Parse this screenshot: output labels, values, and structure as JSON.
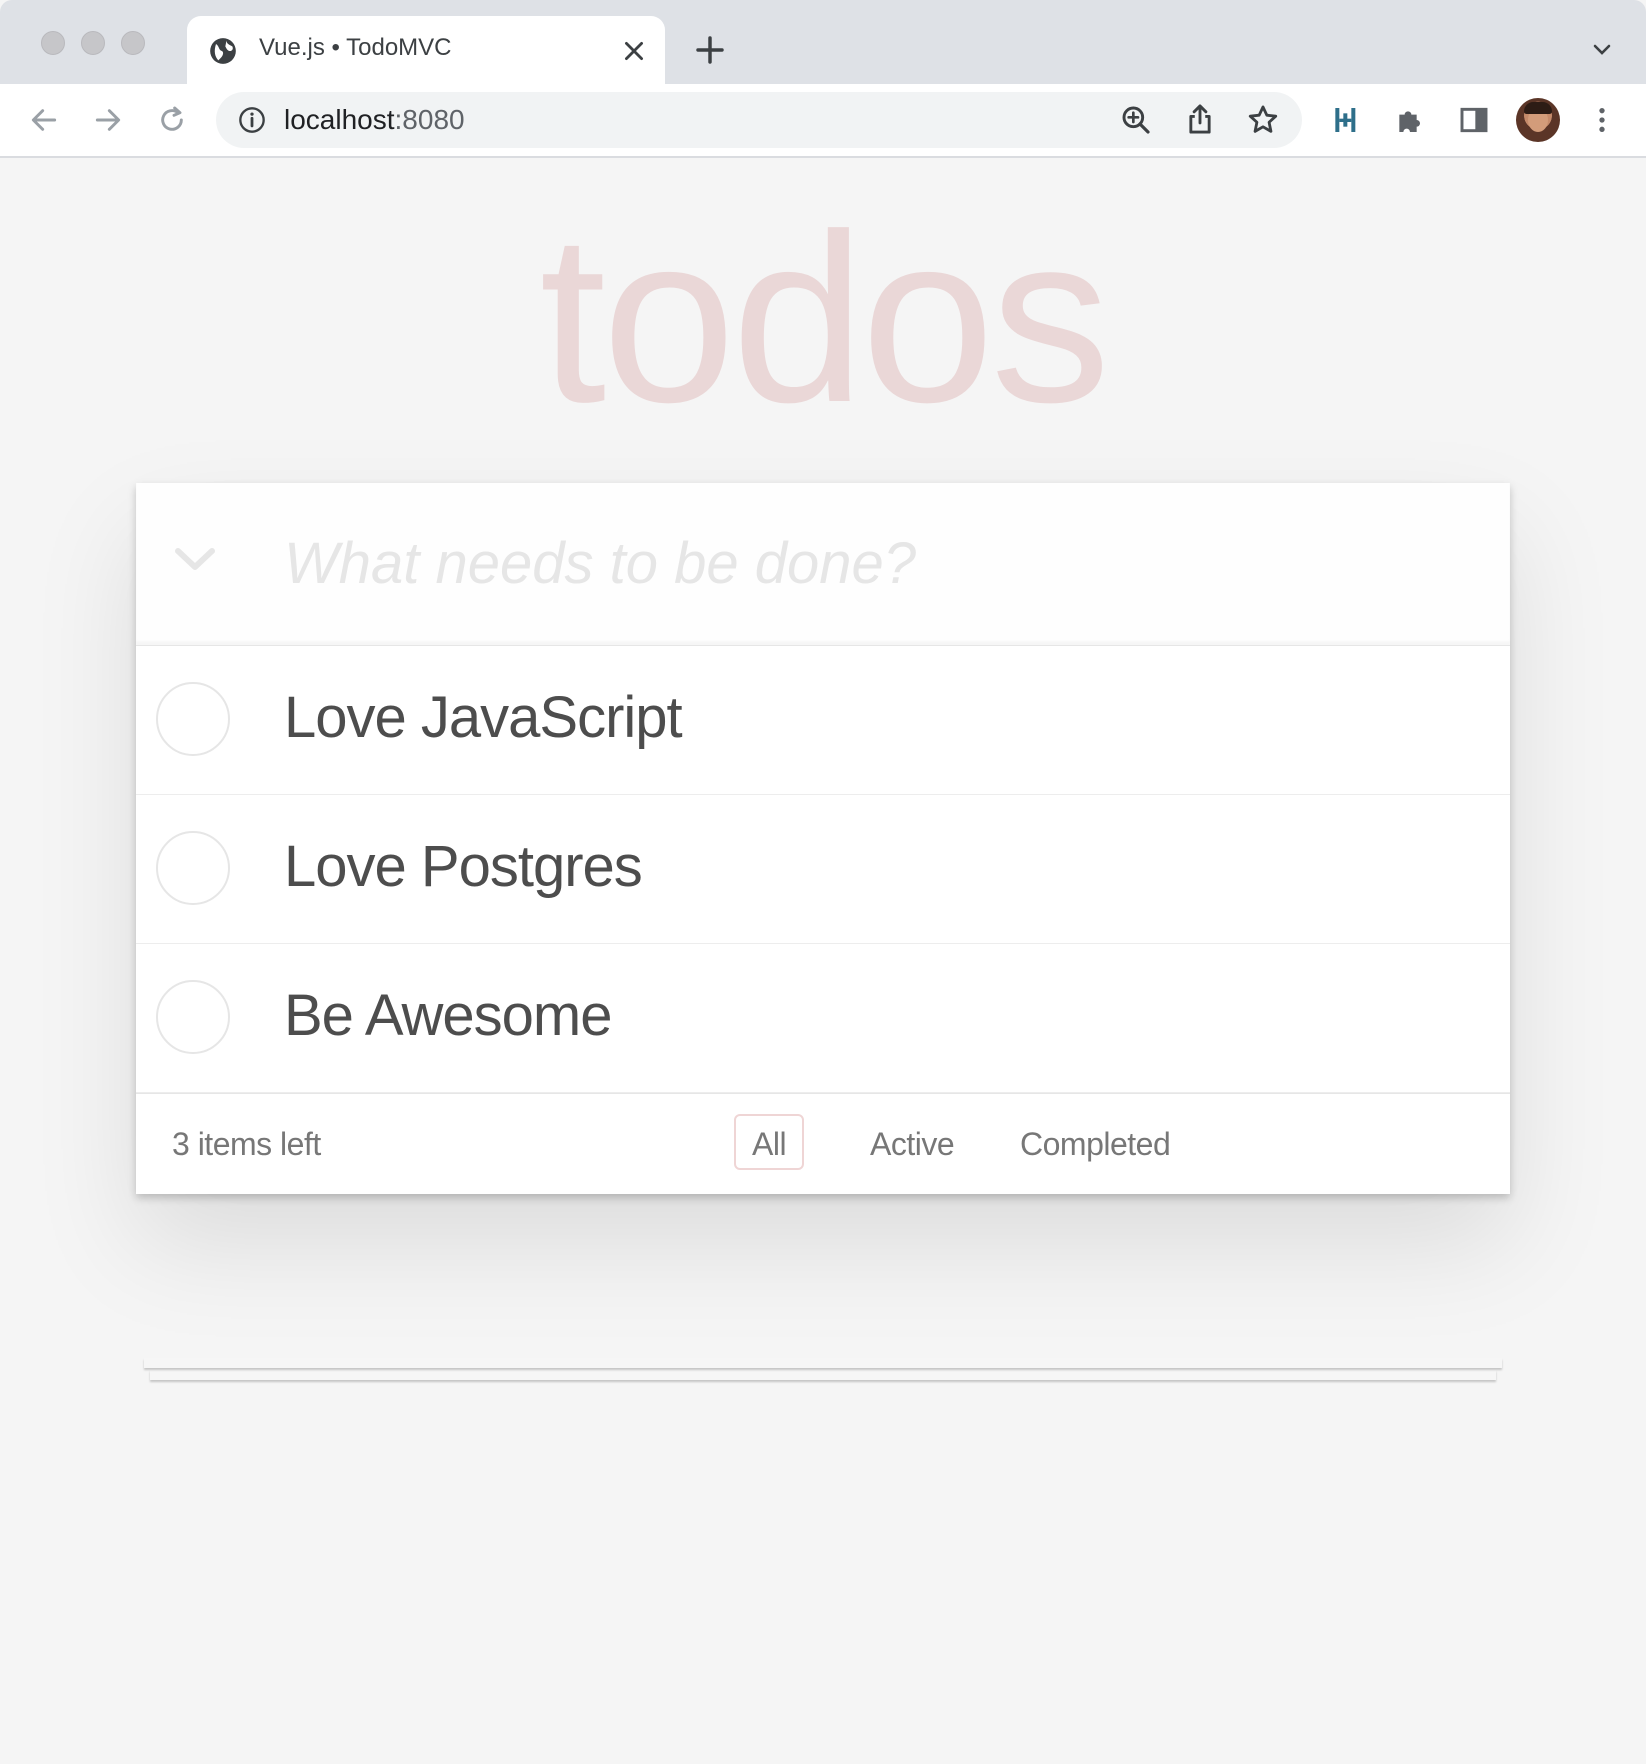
{
  "browser": {
    "tab": {
      "title": "Vue.js • TodoMVC",
      "icon": "globe-icon",
      "close_icon": "close-icon"
    },
    "new_tab_icon": "plus-icon",
    "tab_menu_icon": "chevron-down-icon",
    "nav": {
      "back_icon": "arrow-left-icon",
      "forward_icon": "arrow-right-icon",
      "reload_icon": "reload-icon"
    },
    "omnibox": {
      "host": "localhost",
      "port": ":8080",
      "info_icon": "info-icon",
      "zoom_icon": "zoom-in-icon",
      "share_icon": "share-icon",
      "bookmark_icon": "star-icon"
    },
    "extensions": [
      "extension-app-icon",
      "puzzle-icon",
      "side-panel-icon"
    ],
    "profile": "avatar",
    "menu_icon": "kebab-menu-icon",
    "colors": {
      "tabbar": "#dee1e6",
      "toolbar": "#ffffff",
      "omnibox": "#f1f3f4"
    }
  },
  "app": {
    "title": "todos",
    "new_todo_placeholder": "What needs to be done?",
    "toggle_all_icon": "chevron-down-icon",
    "todos": [
      {
        "label": "Love JavaScript",
        "completed": false
      },
      {
        "label": "Love Postgres",
        "completed": false
      },
      {
        "label": "Be Awesome",
        "completed": false
      }
    ],
    "footer": {
      "count": "3 items left",
      "filters": [
        "All",
        "Active",
        "Completed"
      ],
      "selected_filter": "All"
    },
    "colors": {
      "background": "#f5f5f5",
      "title": "rgba(175,47,47,0.15)",
      "text": "#4d4d4d",
      "muted": "#777777"
    }
  }
}
